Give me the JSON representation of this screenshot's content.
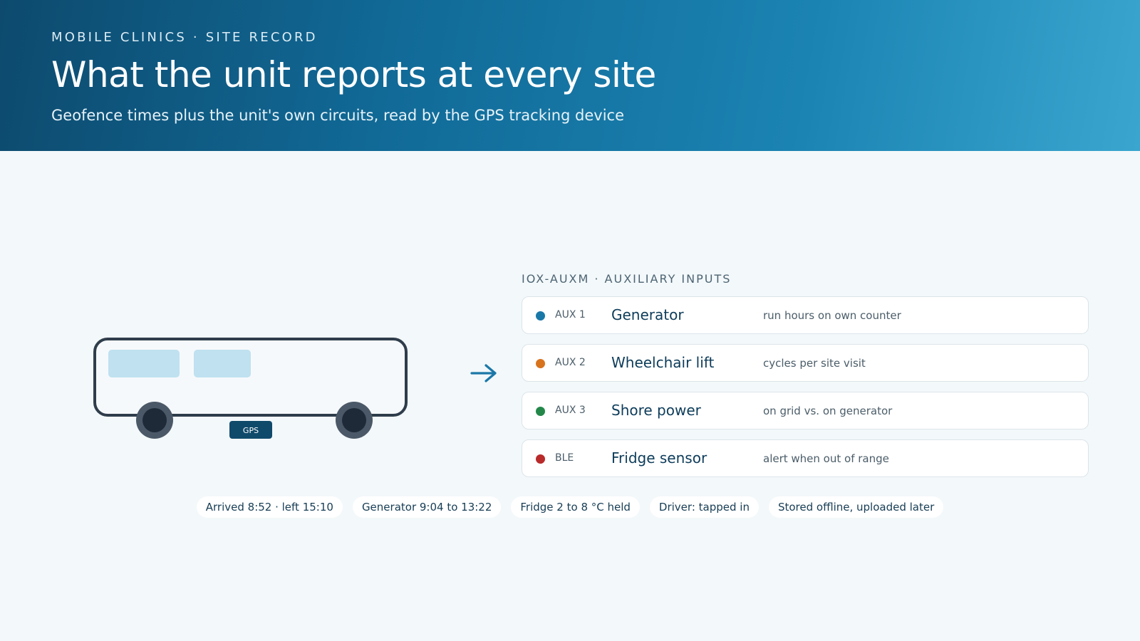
{
  "header": {
    "eyebrow": "MOBILE CLINICS · SITE RECORD",
    "title": "What the unit reports at every site",
    "subtitle": "Geofence times plus the unit's own circuits, read by the GPS tracking device"
  },
  "vehicle": {
    "device_label": "GPS"
  },
  "panel": {
    "label": "IOX-AUXM · AUXILIARY INPUTS",
    "rows": [
      {
        "code": "AUX 1",
        "name": "Generator",
        "desc": "run hours on own counter",
        "color": "#1a78a8"
      },
      {
        "code": "AUX 2",
        "name": "Wheelchair lift",
        "desc": "cycles per site visit",
        "color": "#d8731d"
      },
      {
        "code": "AUX 3",
        "name": "Shore power",
        "desc": "on grid vs. on generator",
        "color": "#23874a"
      },
      {
        "code": "BLE",
        "name": "Fridge sensor",
        "desc": "alert when out of range",
        "color": "#b92a2a"
      }
    ]
  },
  "chips": [
    "Arrived 8:52 · left 15:10",
    "Generator 9:04 to 13:22",
    "Fridge 2 to 8 °C held",
    "Driver: tapped in",
    "Stored offline, uploaded later"
  ],
  "colors": {
    "accent": "#1a78a8",
    "header_dark": "#0d4a6e",
    "header_light": "#3aa6cf",
    "body_bg": "#f3f8fa"
  }
}
